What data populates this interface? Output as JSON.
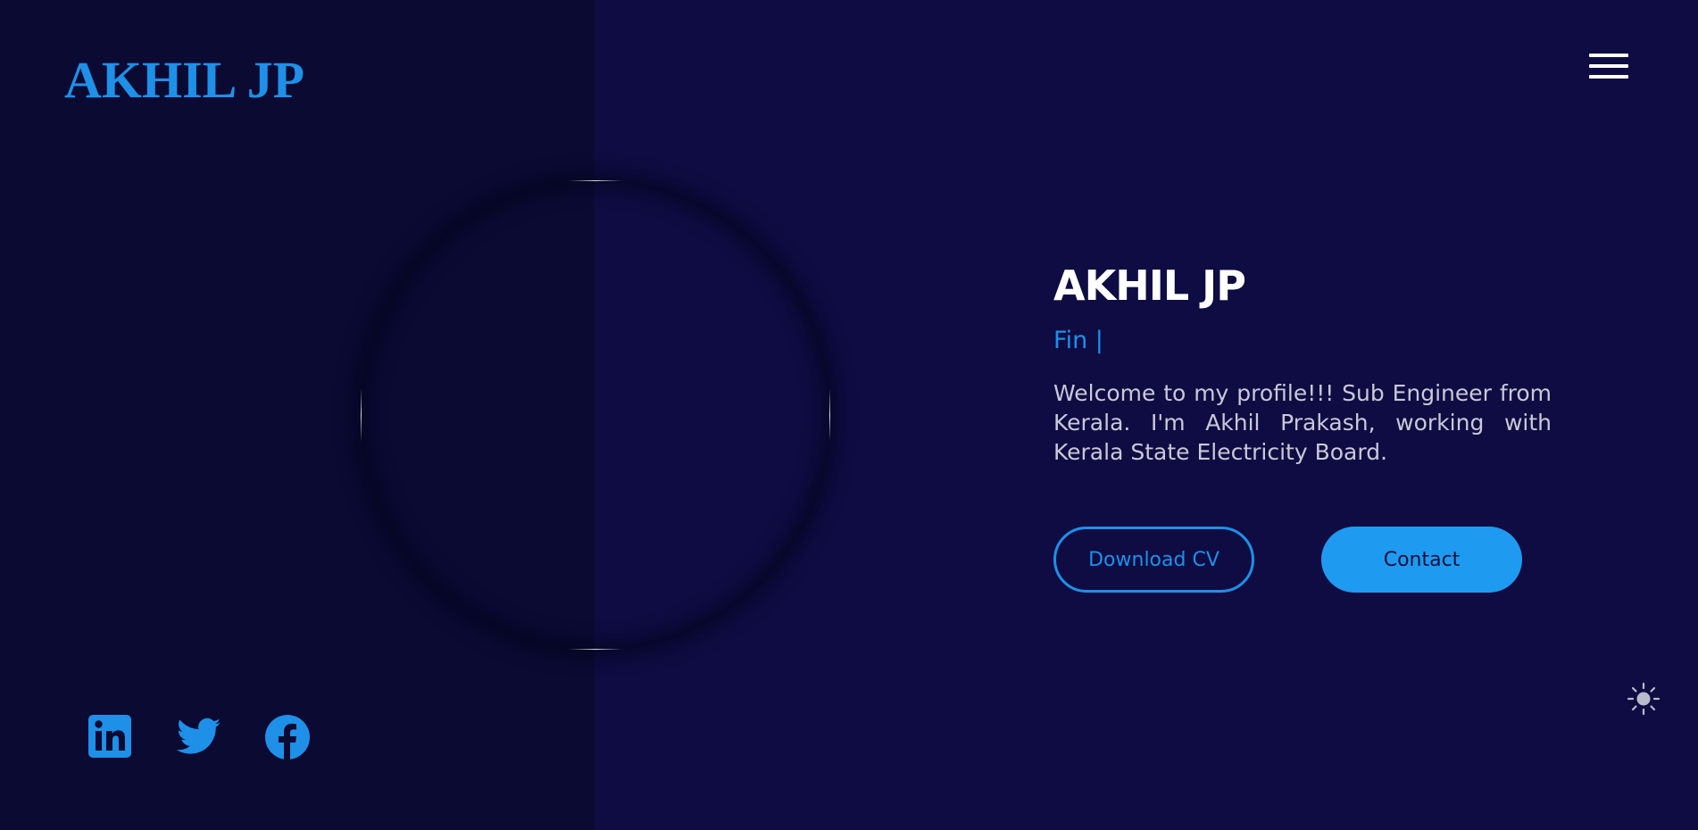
{
  "header": {
    "logo_text": "AKHIL JP",
    "menu_icon": "hamburger-menu-icon"
  },
  "hero": {
    "name": "AKHIL JP",
    "role_text": "Fin",
    "role_cursor": "|",
    "bio": "Welcome to my profile!!! Sub Engineer from Kerala. I'm Akhil Prakash, working with Kerala State Electricity Board.",
    "download_cv_label": "Download CV",
    "contact_label": "Contact"
  },
  "socials": [
    {
      "icon": "linkedin-icon"
    },
    {
      "icon": "twitter-icon"
    },
    {
      "icon": "facebook-icon"
    }
  ],
  "theme_toggle_icon": "sun-icon",
  "colors": {
    "accent": "#1e90e8",
    "background": "#0e0c42",
    "left_panel": "#0a0a33",
    "text_primary": "#ffffff",
    "text_secondary": "#c9c9d8"
  }
}
